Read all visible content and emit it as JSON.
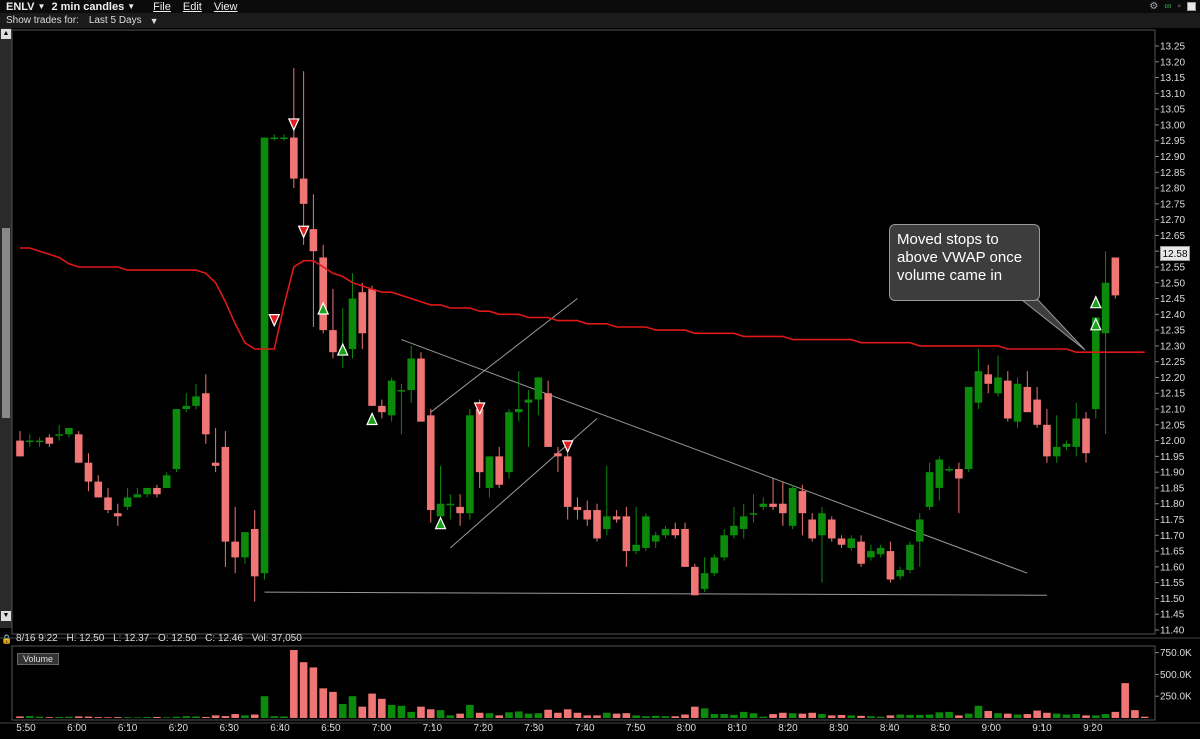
{
  "window": {
    "ticker": "ENLV",
    "period": "2 min candles",
    "menus": [
      "File",
      "Edit",
      "View"
    ]
  },
  "toolbar": {
    "show_trades_label": "Show trades for:",
    "show_trades_value": "Last 5 Days"
  },
  "info_bar": {
    "date": "8/16 9:22",
    "high": "H: 12.50",
    "low": "L: 12.37",
    "open": "O: 12.50",
    "close": "C: 12.46",
    "volume": "Vol: 37,050"
  },
  "annotation": {
    "text": "Moved stops to above VWAP once volume came in"
  },
  "last_price": "12.58",
  "volume_panel": {
    "label": "Volume",
    "ticks": [
      "750.0K",
      "500.0K",
      "250.0K"
    ]
  },
  "colors": {
    "up": "#0b8a0b",
    "down": "#f07575",
    "vwap": "#e01818",
    "trendline": "#9a9a9a"
  },
  "chart_data": {
    "type": "candlestick",
    "price_axis": {
      "ylim": [
        11.4,
        13.25
      ],
      "ticks": [
        "13.25",
        "13.20",
        "13.15",
        "13.10",
        "13.05",
        "13.00",
        "12.95",
        "12.90",
        "12.85",
        "12.80",
        "12.75",
        "12.70",
        "12.65",
        "12.60",
        "12.55",
        "12.50",
        "12.45",
        "12.40",
        "12.35",
        "12.30",
        "12.25",
        "12.20",
        "12.15",
        "12.10",
        "12.05",
        "12.00",
        "11.95",
        "11.90",
        "11.85",
        "11.80",
        "11.75",
        "11.70",
        "11.65",
        "11.60",
        "11.55",
        "11.50",
        "11.45",
        "11.40"
      ]
    },
    "time_axis": {
      "ticks": [
        "5:50",
        "6:00",
        "6:10",
        "6:20",
        "6:30",
        "6:40",
        "6:50",
        "7:00",
        "7:10",
        "7:20",
        "7:30",
        "7:40",
        "7:50",
        "8:00",
        "8:10",
        "8:20",
        "8:30",
        "8:40",
        "8:50",
        "9:00",
        "9:10",
        "9:20"
      ]
    },
    "candles": [
      {
        "o": 12.0,
        "h": 12.03,
        "l": 11.95,
        "c": 11.95
      },
      {
        "o": 12.0,
        "h": 12.02,
        "l": 11.98,
        "c": 12.0
      },
      {
        "o": 12.0,
        "h": 12.01,
        "l": 11.98,
        "c": 12.0
      },
      {
        "o": 12.01,
        "h": 12.02,
        "l": 11.98,
        "c": 11.99
      },
      {
        "o": 12.02,
        "h": 12.05,
        "l": 12.0,
        "c": 12.02
      },
      {
        "o": 12.02,
        "h": 12.04,
        "l": 12.01,
        "c": 12.04
      },
      {
        "o": 12.02,
        "h": 12.03,
        "l": 11.93,
        "c": 11.93
      },
      {
        "o": 11.93,
        "h": 11.96,
        "l": 11.84,
        "c": 11.87
      },
      {
        "o": 11.87,
        "h": 11.89,
        "l": 11.82,
        "c": 11.82
      },
      {
        "o": 11.82,
        "h": 11.85,
        "l": 11.77,
        "c": 11.78
      },
      {
        "o": 11.77,
        "h": 11.8,
        "l": 11.73,
        "c": 11.76
      },
      {
        "o": 11.79,
        "h": 11.85,
        "l": 11.78,
        "c": 11.82
      },
      {
        "o": 11.82,
        "h": 11.85,
        "l": 11.82,
        "c": 11.83
      },
      {
        "o": 11.83,
        "h": 11.85,
        "l": 11.82,
        "c": 11.85
      },
      {
        "o": 11.85,
        "h": 11.86,
        "l": 11.82,
        "c": 11.83
      },
      {
        "o": 11.85,
        "h": 11.9,
        "l": 11.85,
        "c": 11.89
      },
      {
        "o": 11.91,
        "h": 12.05,
        "l": 11.9,
        "c": 12.1
      },
      {
        "o": 12.1,
        "h": 12.15,
        "l": 12.09,
        "c": 12.11
      },
      {
        "o": 12.11,
        "h": 12.18,
        "l": 12.1,
        "c": 12.14
      },
      {
        "o": 12.15,
        "h": 12.21,
        "l": 11.99,
        "c": 12.02
      },
      {
        "o": 11.93,
        "h": 12.04,
        "l": 11.9,
        "c": 11.92
      },
      {
        "o": 11.98,
        "h": 12.03,
        "l": 11.6,
        "c": 11.68
      },
      {
        "o": 11.68,
        "h": 11.79,
        "l": 11.58,
        "c": 11.63
      },
      {
        "o": 11.63,
        "h": 11.71,
        "l": 11.61,
        "c": 11.71
      },
      {
        "o": 11.72,
        "h": 11.78,
        "l": 11.49,
        "c": 11.57
      },
      {
        "o": 11.58,
        "h": 12.96,
        "l": 11.56,
        "c": 12.96
      },
      {
        "o": 12.96,
        "h": 12.97,
        "l": 12.95,
        "c": 12.96
      },
      {
        "o": 12.96,
        "h": 12.97,
        "l": 12.95,
        "c": 12.96
      },
      {
        "o": 12.96,
        "h": 13.18,
        "l": 12.8,
        "c": 12.83
      },
      {
        "o": 12.83,
        "h": 13.17,
        "l": 12.62,
        "c": 12.75
      },
      {
        "o": 12.67,
        "h": 12.78,
        "l": 12.36,
        "c": 12.6
      },
      {
        "o": 12.58,
        "h": 12.62,
        "l": 12.34,
        "c": 12.35
      },
      {
        "o": 12.35,
        "h": 12.48,
        "l": 12.26,
        "c": 12.28
      },
      {
        "o": 12.28,
        "h": 12.42,
        "l": 12.23,
        "c": 12.29
      },
      {
        "o": 12.29,
        "h": 12.53,
        "l": 12.26,
        "c": 12.45
      },
      {
        "o": 12.47,
        "h": 12.5,
        "l": 12.29,
        "c": 12.34
      },
      {
        "o": 12.48,
        "h": 12.49,
        "l": 12.11,
        "c": 12.11
      },
      {
        "o": 12.11,
        "h": 12.13,
        "l": 12.07,
        "c": 12.09
      },
      {
        "o": 12.08,
        "h": 12.2,
        "l": 12.06,
        "c": 12.19
      },
      {
        "o": 12.16,
        "h": 12.18,
        "l": 12.02,
        "c": 12.16
      },
      {
        "o": 12.16,
        "h": 12.3,
        "l": 12.12,
        "c": 12.26
      },
      {
        "o": 12.26,
        "h": 12.28,
        "l": 12.06,
        "c": 12.06
      },
      {
        "o": 12.08,
        "h": 12.1,
        "l": 11.74,
        "c": 11.78
      },
      {
        "o": 11.76,
        "h": 11.92,
        "l": 11.72,
        "c": 11.8
      },
      {
        "o": 11.8,
        "h": 11.83,
        "l": 11.75,
        "c": 11.8
      },
      {
        "o": 11.79,
        "h": 11.83,
        "l": 11.73,
        "c": 11.77
      },
      {
        "o": 11.77,
        "h": 12.1,
        "l": 11.75,
        "c": 12.08
      },
      {
        "o": 12.1,
        "h": 12.13,
        "l": 11.85,
        "c": 11.9
      },
      {
        "o": 11.85,
        "h": 11.95,
        "l": 11.82,
        "c": 11.95
      },
      {
        "o": 11.95,
        "h": 11.98,
        "l": 11.85,
        "c": 11.86
      },
      {
        "o": 11.9,
        "h": 12.1,
        "l": 11.88,
        "c": 12.09
      },
      {
        "o": 12.09,
        "h": 12.22,
        "l": 12.06,
        "c": 12.1
      },
      {
        "o": 12.12,
        "h": 12.16,
        "l": 11.98,
        "c": 12.13
      },
      {
        "o": 12.13,
        "h": 12.2,
        "l": 12.08,
        "c": 12.2
      },
      {
        "o": 12.15,
        "h": 12.19,
        "l": 11.98,
        "c": 11.98
      },
      {
        "o": 11.96,
        "h": 11.98,
        "l": 11.9,
        "c": 11.95
      },
      {
        "o": 11.95,
        "h": 11.96,
        "l": 11.75,
        "c": 11.79
      },
      {
        "o": 11.79,
        "h": 11.82,
        "l": 11.75,
        "c": 11.78
      },
      {
        "o": 11.78,
        "h": 11.81,
        "l": 11.73,
        "c": 11.75
      },
      {
        "o": 11.78,
        "h": 11.8,
        "l": 11.68,
        "c": 11.69
      },
      {
        "o": 11.72,
        "h": 11.92,
        "l": 11.7,
        "c": 11.76
      },
      {
        "o": 11.76,
        "h": 11.78,
        "l": 11.74,
        "c": 11.75
      },
      {
        "o": 11.76,
        "h": 11.79,
        "l": 11.6,
        "c": 11.65
      },
      {
        "o": 11.65,
        "h": 11.79,
        "l": 11.64,
        "c": 11.67
      },
      {
        "o": 11.66,
        "h": 11.77,
        "l": 11.65,
        "c": 11.76
      },
      {
        "o": 11.68,
        "h": 11.71,
        "l": 11.66,
        "c": 11.7
      },
      {
        "o": 11.7,
        "h": 11.73,
        "l": 11.69,
        "c": 11.72
      },
      {
        "o": 11.72,
        "h": 11.74,
        "l": 11.69,
        "c": 11.7
      },
      {
        "o": 11.72,
        "h": 11.74,
        "l": 11.6,
        "c": 11.6
      },
      {
        "o": 11.6,
        "h": 11.61,
        "l": 11.51,
        "c": 11.51
      },
      {
        "o": 11.53,
        "h": 11.63,
        "l": 11.52,
        "c": 11.58
      },
      {
        "o": 11.58,
        "h": 11.64,
        "l": 11.57,
        "c": 11.63
      },
      {
        "o": 11.63,
        "h": 11.72,
        "l": 11.62,
        "c": 11.7
      },
      {
        "o": 11.7,
        "h": 11.79,
        "l": 11.69,
        "c": 11.73
      },
      {
        "o": 11.72,
        "h": 11.8,
        "l": 11.69,
        "c": 11.76
      },
      {
        "o": 11.77,
        "h": 11.83,
        "l": 11.74,
        "c": 11.77
      },
      {
        "o": 11.79,
        "h": 11.82,
        "l": 11.78,
        "c": 11.8
      },
      {
        "o": 11.8,
        "h": 11.88,
        "l": 11.78,
        "c": 11.79
      },
      {
        "o": 11.8,
        "h": 11.87,
        "l": 11.73,
        "c": 11.77
      },
      {
        "o": 11.73,
        "h": 11.86,
        "l": 11.72,
        "c": 11.85
      },
      {
        "o": 11.84,
        "h": 11.86,
        "l": 11.7,
        "c": 11.77
      },
      {
        "o": 11.75,
        "h": 11.77,
        "l": 11.68,
        "c": 11.69
      },
      {
        "o": 11.7,
        "h": 11.79,
        "l": 11.55,
        "c": 11.77
      },
      {
        "o": 11.75,
        "h": 11.76,
        "l": 11.68,
        "c": 11.69
      },
      {
        "o": 11.69,
        "h": 11.7,
        "l": 11.66,
        "c": 11.67
      },
      {
        "o": 11.66,
        "h": 11.7,
        "l": 11.65,
        "c": 11.69
      },
      {
        "o": 11.68,
        "h": 11.7,
        "l": 11.6,
        "c": 11.61
      },
      {
        "o": 11.63,
        "h": 11.67,
        "l": 11.62,
        "c": 11.65
      },
      {
        "o": 11.64,
        "h": 11.67,
        "l": 11.63,
        "c": 11.66
      },
      {
        "o": 11.65,
        "h": 11.68,
        "l": 11.55,
        "c": 11.56
      },
      {
        "o": 11.57,
        "h": 11.6,
        "l": 11.56,
        "c": 11.59
      },
      {
        "o": 11.59,
        "h": 11.68,
        "l": 11.58,
        "c": 11.67
      },
      {
        "o": 11.68,
        "h": 11.77,
        "l": 11.6,
        "c": 11.75
      },
      {
        "o": 11.79,
        "h": 11.93,
        "l": 11.78,
        "c": 11.9
      },
      {
        "o": 11.85,
        "h": 11.95,
        "l": 11.81,
        "c": 11.94
      },
      {
        "o": 11.91,
        "h": 11.92,
        "l": 11.9,
        "c": 11.91
      },
      {
        "o": 11.91,
        "h": 11.93,
        "l": 11.77,
        "c": 11.88
      },
      {
        "o": 11.91,
        "h": 12.17,
        "l": 11.9,
        "c": 12.17
      },
      {
        "o": 12.12,
        "h": 12.29,
        "l": 12.1,
        "c": 12.22
      },
      {
        "o": 12.21,
        "h": 12.24,
        "l": 12.15,
        "c": 12.18
      },
      {
        "o": 12.15,
        "h": 12.27,
        "l": 12.14,
        "c": 12.2
      },
      {
        "o": 12.19,
        "h": 12.22,
        "l": 12.06,
        "c": 12.07
      },
      {
        "o": 12.06,
        "h": 12.2,
        "l": 12.04,
        "c": 12.18
      },
      {
        "o": 12.17,
        "h": 12.22,
        "l": 12.1,
        "c": 12.09
      },
      {
        "o": 12.13,
        "h": 12.17,
        "l": 12.04,
        "c": 12.05
      },
      {
        "o": 12.05,
        "h": 12.1,
        "l": 11.93,
        "c": 11.95
      },
      {
        "o": 11.95,
        "h": 12.08,
        "l": 11.93,
        "c": 11.98
      },
      {
        "o": 11.98,
        "h": 12.0,
        "l": 11.97,
        "c": 11.99
      },
      {
        "o": 11.98,
        "h": 12.12,
        "l": 11.95,
        "c": 12.07
      },
      {
        "o": 12.07,
        "h": 12.09,
        "l": 11.93,
        "c": 11.96
      },
      {
        "o": 12.1,
        "h": 12.39,
        "l": 12.07,
        "c": 12.39
      },
      {
        "o": 12.34,
        "h": 12.6,
        "l": 12.02,
        "c": 12.5
      },
      {
        "o": 12.58,
        "h": 12.58,
        "l": 12.45,
        "c": 12.46
      }
    ],
    "volume_k": [
      18,
      22,
      15,
      9,
      12,
      14,
      18,
      16,
      10,
      8,
      10,
      9,
      7,
      10,
      12,
      8,
      14,
      20,
      18,
      12,
      30,
      22,
      45,
      30,
      40,
      250,
      20,
      18,
      780,
      640,
      580,
      340,
      300,
      160,
      250,
      130,
      280,
      220,
      150,
      140,
      70,
      130,
      100,
      90,
      30,
      50,
      150,
      60,
      55,
      30,
      65,
      75,
      50,
      55,
      95,
      60,
      100,
      60,
      30,
      30,
      60,
      50,
      55,
      30,
      20,
      25,
      20,
      20,
      40,
      130,
      110,
      45,
      45,
      35,
      70,
      55,
      15,
      45,
      60,
      55,
      50,
      60,
      45,
      30,
      35,
      30,
      25,
      20,
      15,
      30,
      40,
      35,
      35,
      40,
      65,
      70,
      30,
      50,
      140,
      80,
      55,
      50,
      40,
      45,
      85,
      60,
      50,
      40,
      45,
      30,
      30,
      45,
      70,
      400,
      90,
      15
    ],
    "vwap": [
      12.61,
      12.61,
      12.6,
      12.59,
      12.58,
      12.56,
      12.55,
      12.55,
      12.55,
      12.55,
      12.55,
      12.54,
      12.54,
      12.54,
      12.54,
      12.54,
      12.54,
      12.54,
      12.54,
      12.53,
      12.5,
      12.44,
      12.37,
      12.31,
      12.29,
      12.29,
      12.29,
      12.43,
      12.55,
      12.57,
      12.57,
      12.55,
      12.53,
      12.52,
      12.5,
      12.49,
      12.48,
      12.47,
      12.47,
      12.46,
      12.45,
      12.44,
      12.43,
      12.43,
      12.42,
      12.42,
      12.42,
      12.41,
      12.41,
      12.4,
      12.4,
      12.4,
      12.39,
      12.39,
      12.39,
      12.38,
      12.38,
      12.38,
      12.37,
      12.37,
      12.37,
      12.36,
      12.36,
      12.36,
      12.36,
      12.35,
      12.35,
      12.35,
      12.35,
      12.34,
      12.34,
      12.34,
      12.34,
      12.34,
      12.33,
      12.33,
      12.33,
      12.33,
      12.33,
      12.32,
      12.32,
      12.32,
      12.32,
      12.32,
      12.32,
      12.32,
      12.31,
      12.31,
      12.31,
      12.31,
      12.31,
      12.31,
      12.3,
      12.3,
      12.3,
      12.3,
      12.3,
      12.3,
      12.3,
      12.3,
      12.3,
      12.29,
      12.29,
      12.29,
      12.29,
      12.29,
      12.29,
      12.29,
      12.28,
      12.28,
      12.28,
      12.28,
      12.28,
      12.28,
      12.28,
      12.28
    ],
    "trade_markers": [
      {
        "bar": 28,
        "type": "sell",
        "price": 13.0
      },
      {
        "bar": 29,
        "type": "sell",
        "price": 12.66
      },
      {
        "bar": 26,
        "type": "sell",
        "price": 12.38
      },
      {
        "bar": 31,
        "type": "buy",
        "price": 12.42
      },
      {
        "bar": 33,
        "type": "buy",
        "price": 12.29
      },
      {
        "bar": 36,
        "type": "buy",
        "price": 12.07
      },
      {
        "bar": 43,
        "type": "buy",
        "price": 11.74
      },
      {
        "bar": 47,
        "type": "sell",
        "price": 12.1
      },
      {
        "bar": 56,
        "type": "sell",
        "price": 11.98
      },
      {
        "bar": 110,
        "type": "buy",
        "price": 12.44
      },
      {
        "bar": 110,
        "type": "buy",
        "price": 12.37
      }
    ],
    "trendlines": [
      {
        "from": {
          "bar": 25,
          "price": 11.52
        },
        "to": {
          "bar": 105,
          "price": 11.51
        }
      },
      {
        "from": {
          "bar": 39,
          "price": 12.32
        },
        "to": {
          "bar": 103,
          "price": 11.58
        }
      },
      {
        "from": {
          "bar": 42,
          "price": 12.09
        },
        "to": {
          "bar": 57,
          "price": 12.45
        }
      },
      {
        "from": {
          "bar": 44,
          "price": 11.66
        },
        "to": {
          "bar": 59,
          "price": 12.07
        }
      }
    ]
  }
}
